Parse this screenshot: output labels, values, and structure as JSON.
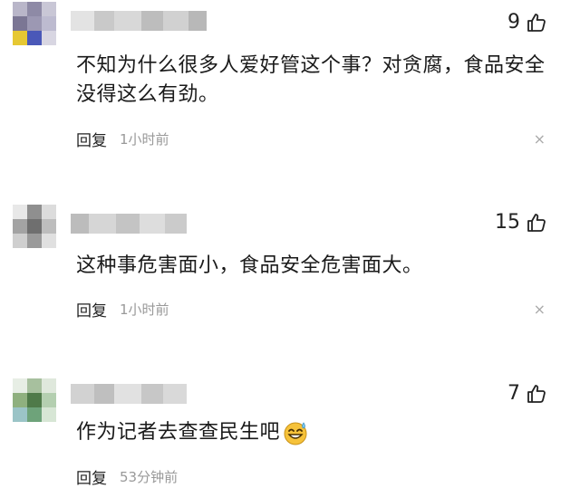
{
  "comments": [
    {
      "likes": "9",
      "text_lines": [
        "不知为什么很多人爱好管这个事？对贪腐，食品安全",
        "没得这么有劲。"
      ],
      "reply_label": "回复",
      "time": "1小时前",
      "close_glyph": "×"
    },
    {
      "likes": "15",
      "text_lines": [
        "这种事危害面小，食品安全危害面大。"
      ],
      "reply_label": "回复",
      "time": "1小时前",
      "close_glyph": "×"
    },
    {
      "likes": "7",
      "text_lines": [
        "作为记者去查查民生吧"
      ],
      "reply_label": "回复",
      "time": "53分钟前"
    }
  ],
  "icons": {
    "like": "thumbs-up-icon",
    "emoji": "sweat-smile-emoji-icon",
    "close": "close-icon"
  },
  "colors": {
    "text": "#1a1a1a",
    "meta": "#999999",
    "emoji_face": "#f6c23a"
  }
}
